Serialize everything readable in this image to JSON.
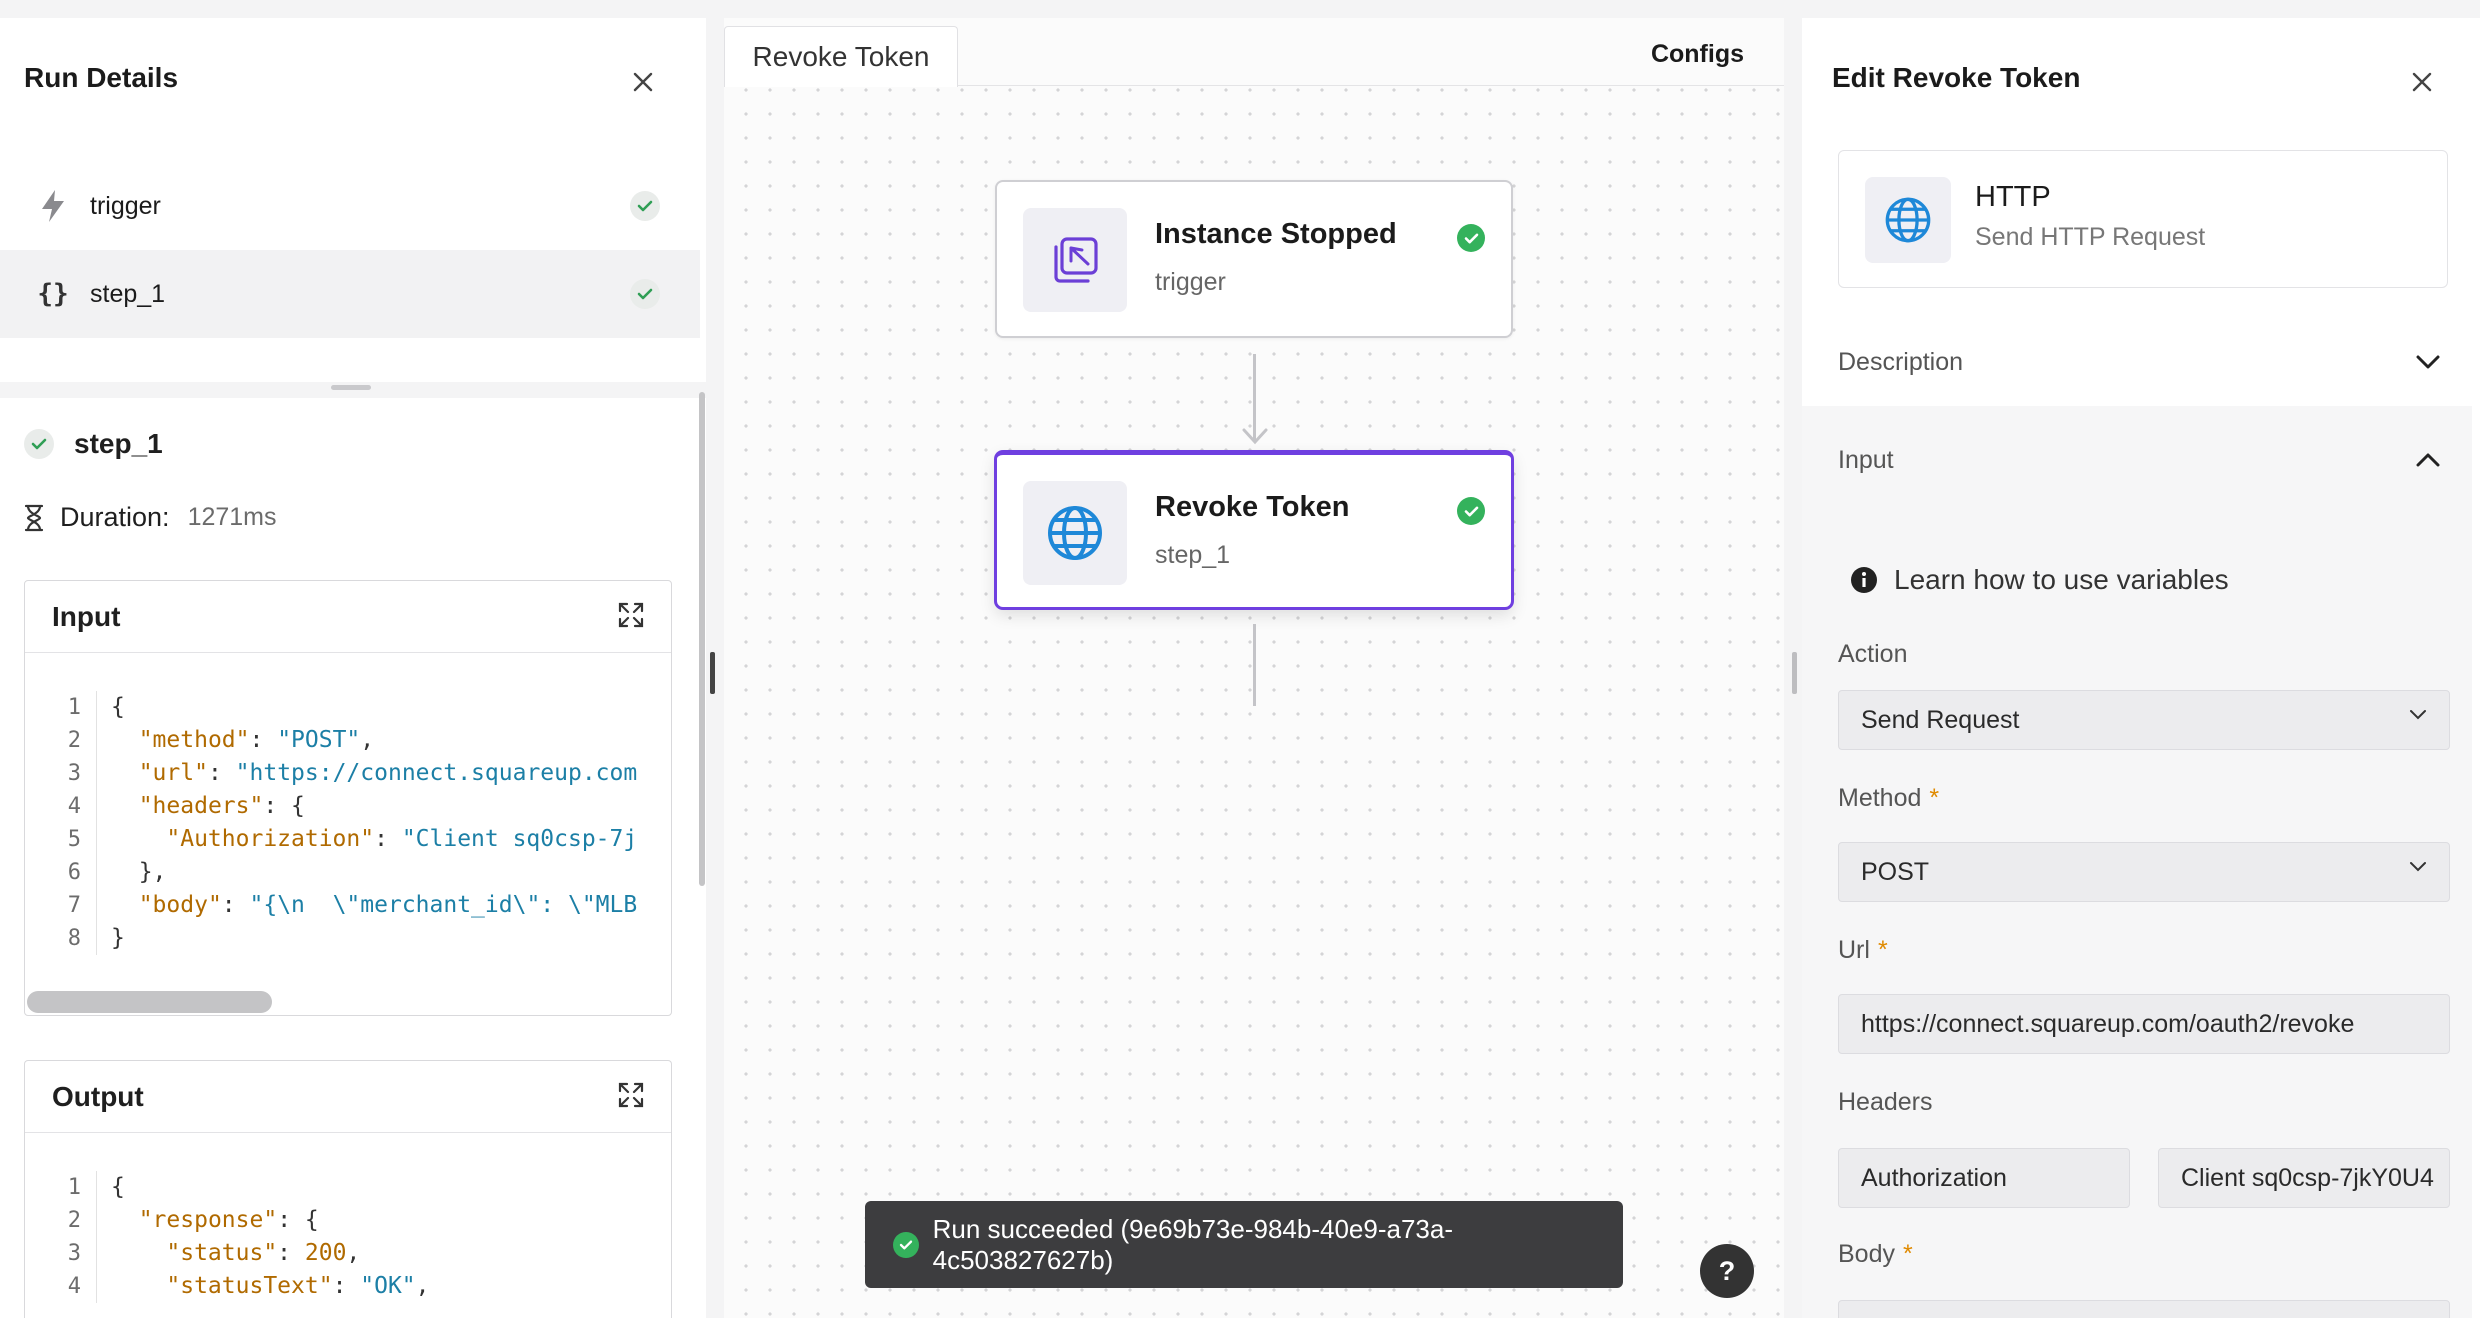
{
  "left_panel": {
    "title": "Run Details",
    "run_items": [
      {
        "icon": "lightning-icon",
        "label": "trigger",
        "status": "success"
      },
      {
        "icon": "braces-icon",
        "label": "step_1",
        "status": "success"
      }
    ],
    "step": {
      "name": "step_1",
      "duration_label": "Duration:",
      "duration_value": "1271ms"
    },
    "input": {
      "title": "Input",
      "lines": [
        [
          [
            "p",
            "{"
          ]
        ],
        [
          [
            "p",
            "  "
          ],
          [
            "k",
            "\"method\""
          ],
          [
            "p",
            ": "
          ],
          [
            "s",
            "\"POST\""
          ],
          [
            "p",
            ","
          ]
        ],
        [
          [
            "p",
            "  "
          ],
          [
            "k",
            "\"url\""
          ],
          [
            "p",
            ": "
          ],
          [
            "s",
            "\"https://connect.squareup.com"
          ]
        ],
        [
          [
            "p",
            "  "
          ],
          [
            "k",
            "\"headers\""
          ],
          [
            "p",
            ": {"
          ]
        ],
        [
          [
            "p",
            "    "
          ],
          [
            "k",
            "\"Authorization\""
          ],
          [
            "p",
            ": "
          ],
          [
            "s",
            "\"Client sq0csp-7j"
          ]
        ],
        [
          [
            "p",
            "  },"
          ]
        ],
        [
          [
            "p",
            "  "
          ],
          [
            "k",
            "\"body\""
          ],
          [
            "p",
            ": "
          ],
          [
            "s",
            "\"{\\n  \\\"merchant_id\\\": \\\"MLB"
          ]
        ],
        [
          [
            "p",
            "}"
          ]
        ]
      ]
    },
    "output": {
      "title": "Output",
      "lines": [
        [
          [
            "p",
            "{"
          ]
        ],
        [
          [
            "p",
            "  "
          ],
          [
            "k",
            "\"response\""
          ],
          [
            "p",
            ": {"
          ]
        ],
        [
          [
            "p",
            "    "
          ],
          [
            "k",
            "\"status\""
          ],
          [
            "p",
            ": "
          ],
          [
            "n",
            "200"
          ],
          [
            "p",
            ","
          ]
        ],
        [
          [
            "p",
            "    "
          ],
          [
            "k",
            "\"statusText\""
          ],
          [
            "p",
            ": "
          ],
          [
            "s",
            "\"OK\""
          ],
          [
            "p",
            ","
          ]
        ]
      ]
    }
  },
  "canvas": {
    "tab_label": "Revoke Token",
    "configs_label": "Configs",
    "nodes": [
      {
        "title": "Instance Stopped",
        "subtitle": "trigger",
        "icon": "instance-stopped-icon",
        "status": "success"
      },
      {
        "title": "Revoke Token",
        "subtitle": "step_1",
        "icon": "globe-icon",
        "status": "success"
      }
    ],
    "toast": "Run succeeded (9e69b73e-984b-40e9-a73a-4c503827627b)",
    "help_label": "?"
  },
  "right_panel": {
    "title": "Edit Revoke Token",
    "http_card": {
      "title": "HTTP",
      "subtitle": "Send HTTP Request"
    },
    "description_label": "Description",
    "input_label": "Input",
    "learn_label": "Learn how to use variables",
    "action": {
      "label": "Action",
      "value": "Send Request"
    },
    "method": {
      "label": "Method",
      "required": "*",
      "value": "POST"
    },
    "url": {
      "label": "Url",
      "required": "*",
      "value": "https://connect.squareup.com/oauth2/revoke"
    },
    "headers": {
      "label": "Headers",
      "key": "Authorization",
      "value": "Client sq0csp-7jkY0U4"
    },
    "body": {
      "label": "Body",
      "required": "*"
    }
  },
  "colors": {
    "accent": "#6f3fe0",
    "success": "#34b25c",
    "link": "#1c7fa6"
  }
}
